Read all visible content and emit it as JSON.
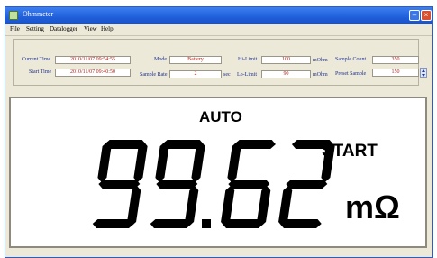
{
  "window": {
    "title": "Ohmmeter",
    "minimize_icon": "minimize-icon",
    "close_icon": "close-icon"
  },
  "menu": [
    "File",
    "Setting",
    "Datalogger",
    "View",
    "Help"
  ],
  "settings": {
    "current_time_label": "Current Time",
    "current_time_value": "2010/11/07 09:54:55",
    "start_time_label": "Start Time",
    "start_time_value": "2010/11/07 09:40:50",
    "mode_label": "Mode",
    "mode_value": "Battery",
    "sample_rate_label": "Sample Rate",
    "sample_rate_value": "2",
    "sample_rate_unit": "sec",
    "hi_limit_label": "Hi-Limit",
    "hi_limit_value": "100",
    "hi_limit_unit": "mOhm",
    "lo_limit_label": "Lo-Limit",
    "lo_limit_value": "90",
    "lo_limit_unit": "mOhm",
    "sample_count_label": "Sample Count",
    "sample_count_value": "350",
    "preset_sample_label": "Preset Sample",
    "preset_sample_value": "150"
  },
  "display": {
    "range_mode": "AUTO",
    "status": "START",
    "reading": "99.62",
    "unit": "mΩ",
    "digit_color": "#000000"
  }
}
